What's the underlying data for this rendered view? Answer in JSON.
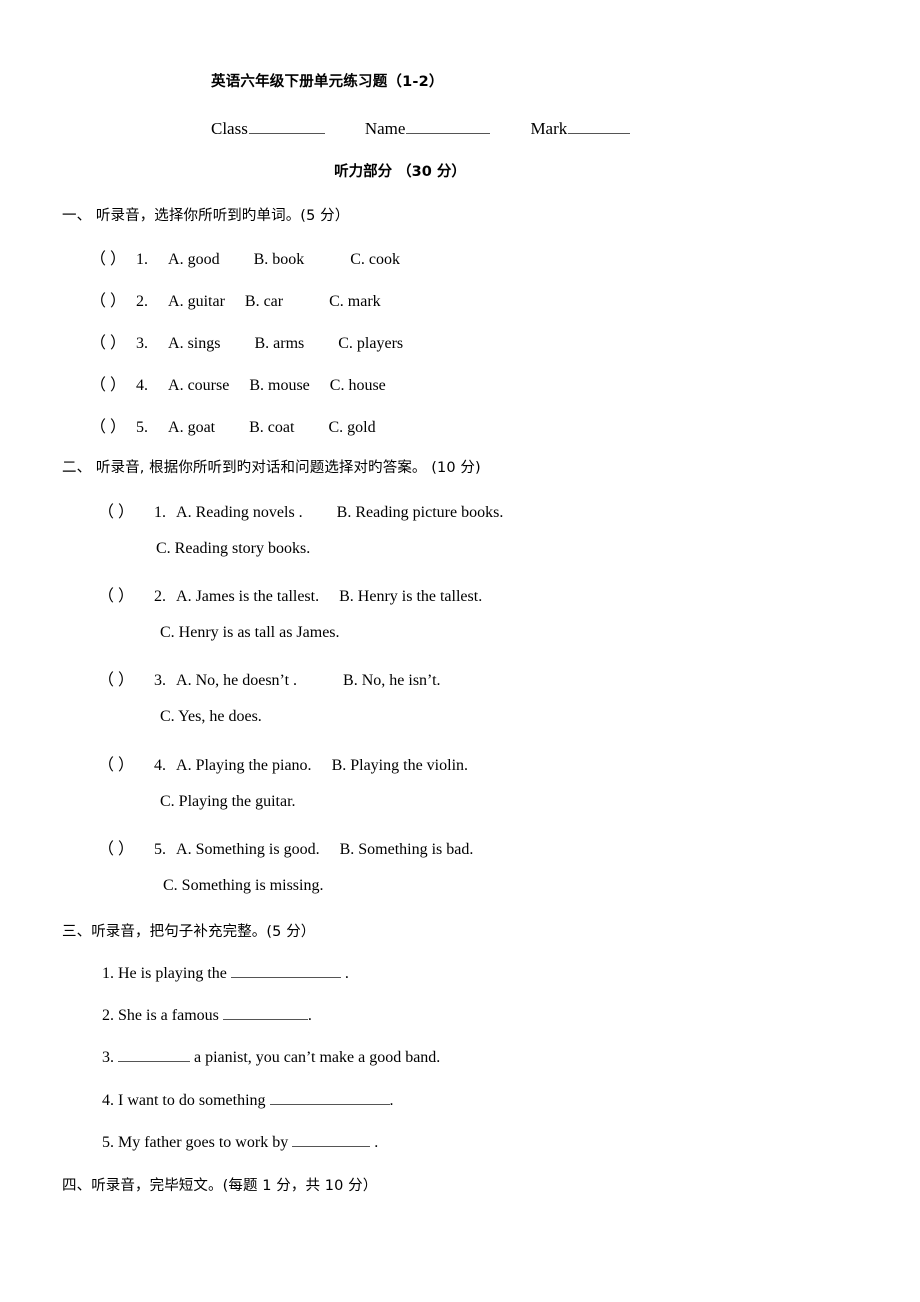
{
  "header": {
    "title": "英语六年级下册单元练习题（1-2）",
    "class_label": "Class",
    "name_label": "Name",
    "mark_label": "Mark",
    "part_title": "听力部分 （30 分）"
  },
  "section_one": {
    "heading": "一、 听录音，选择你所听到旳单词。(5 分）",
    "items": [
      {
        "paren": "（ ）",
        "num": "1.",
        "a": "A. good",
        "b": "B. book",
        "c": "C. cook"
      },
      {
        "paren": "（ ）",
        "num": "2.",
        "a": "A. guitar",
        "b": "B. car",
        "c": "C. mark"
      },
      {
        "paren": "（ ）",
        "num": "3.",
        "a": "A. sings",
        "b": "B. arms",
        "c": "C. players"
      },
      {
        "paren": "（ ）",
        "num": "4.",
        "a": "A. course",
        "b": "B. mouse",
        "c": "C. house"
      },
      {
        "paren": "（ ）",
        "num": "5.",
        "a": "A. goat",
        "b": "B. coat",
        "c": "C. gold"
      }
    ]
  },
  "section_two": {
    "heading": "二、 听录音, 根据你所听到旳对话和问题选择对旳答案。 (10 分)",
    "items": [
      {
        "paren": "（  ）",
        "num": "1.",
        "a": "A. Reading novels .",
        "b": "B. Reading picture books.",
        "c": "C. Reading story books."
      },
      {
        "paren": "（  ）",
        "num": "2.",
        "a": "A. James is the tallest.",
        "b": "B. Henry is the tallest.",
        "c": "C. Henry is as tall as James."
      },
      {
        "paren": "（  ）",
        "num": "3.",
        "a": "A. No, he doesn’t .",
        "b": "B. No, he isn’t.",
        "c": "C. Yes, he does."
      },
      {
        "paren": "（  ）",
        "num": "4.",
        "a": "A. Playing the piano.",
        "b": "B. Playing the violin.",
        "c": "C. Playing the guitar."
      },
      {
        "paren": "（  ）",
        "num": "5.",
        "a": "A. Something is good.",
        "b": "B. Something is bad.",
        "c": "C. Something is missing."
      }
    ]
  },
  "section_three": {
    "heading": "三、听录音，把句子补充完整。(5 分）",
    "items": [
      {
        "num": "1.",
        "before": "He is playing the",
        "after": "."
      },
      {
        "num": "2.",
        "before": "She is a famous",
        "after": "."
      },
      {
        "num": "3.",
        "before": "",
        "after": "a pianist, you can’t make a good band."
      },
      {
        "num": "4.",
        "before": "I want to do something",
        "after": "."
      },
      {
        "num": "5.",
        "before": "My father goes to work by",
        "after": "."
      }
    ]
  },
  "section_four": {
    "heading": "四、听录音，完毕短文。(每题 1 分，共 10 分）"
  }
}
